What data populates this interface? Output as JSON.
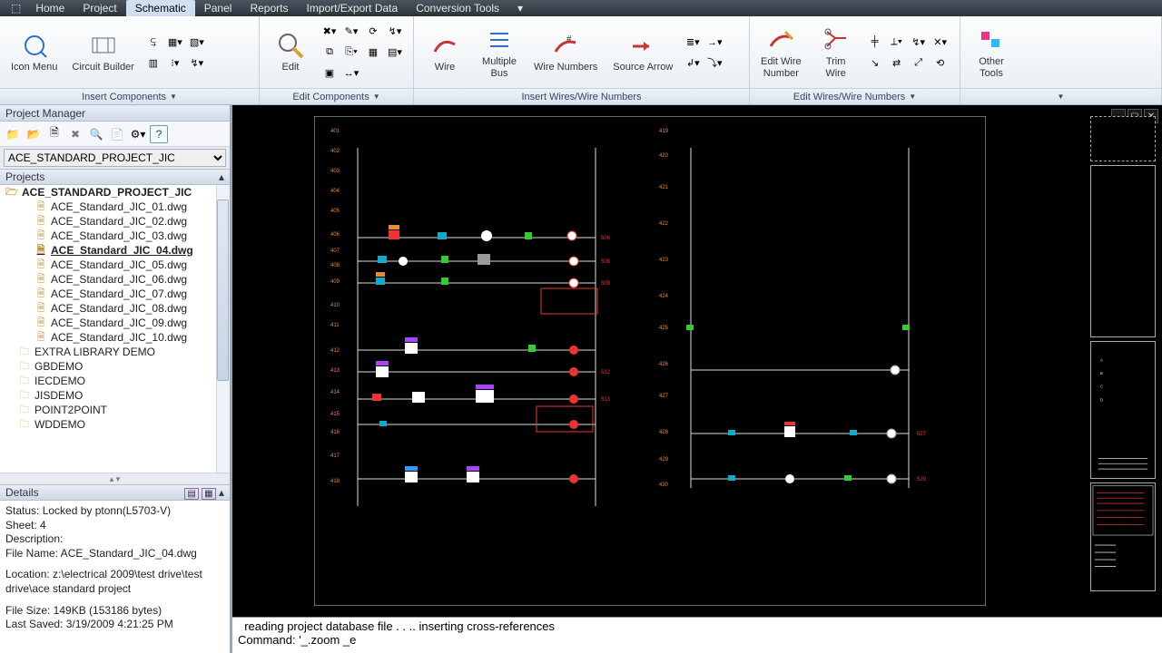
{
  "menu": {
    "items": [
      "Home",
      "Project",
      "Schematic",
      "Panel",
      "Reports",
      "Import/Export Data",
      "Conversion Tools"
    ],
    "active_index": 2
  },
  "ribbon": {
    "groups": [
      {
        "title": "Insert Components",
        "big": [
          {
            "label": "Icon Menu"
          },
          {
            "label": "Circuit Builder"
          }
        ],
        "has_caret": true
      },
      {
        "title": "Edit Components",
        "big": [
          {
            "label": "Edit"
          }
        ],
        "has_caret": true
      },
      {
        "title": "Insert Wires/Wire Numbers",
        "big": [
          {
            "label": "Wire"
          },
          {
            "label": "Multiple\nBus"
          },
          {
            "label": "Wire Numbers"
          },
          {
            "label": "Source Arrow"
          }
        ],
        "has_caret": false
      },
      {
        "title": "Edit Wires/Wire Numbers",
        "big": [
          {
            "label": "Edit Wire\nNumber"
          },
          {
            "label": "Trim\nWire"
          }
        ],
        "has_caret": true
      },
      {
        "title": "",
        "big": [
          {
            "label": "Other\nTools"
          }
        ],
        "has_caret": true
      }
    ]
  },
  "project_manager": {
    "title": "Project Manager",
    "dropdown": "ACE_STANDARD_PROJECT_JIC",
    "section_projects": "Projects",
    "section_details": "Details",
    "tree": {
      "project": "ACE_STANDARD_PROJECT_JIC",
      "drawings": [
        "ACE_Standard_JIC_01.dwg",
        "ACE_Standard_JIC_02.dwg",
        "ACE_Standard_JIC_03.dwg",
        "ACE_Standard_JIC_04.dwg",
        "ACE_Standard_JIC_05.dwg",
        "ACE_Standard_JIC_06.dwg",
        "ACE_Standard_JIC_07.dwg",
        "ACE_Standard_JIC_08.dwg",
        "ACE_Standard_JIC_09.dwg",
        "ACE_Standard_JIC_10.dwg"
      ],
      "selected_index": 3,
      "others": [
        "EXTRA LIBRARY DEMO",
        "GBDEMO",
        "IECDEMO",
        "JISDEMO",
        "POINT2POINT",
        "WDDEMO"
      ]
    },
    "details": {
      "status": "Status: Locked by ptonn(L5703-V)",
      "sheet": "Sheet: 4",
      "description": "Description:",
      "filename": "File Name: ACE_Standard_JIC_04.dwg",
      "location": "Location: z:\\electrical 2009\\test drive\\test drive\\ace standard project",
      "filesize": "File Size: 149KB (153186 bytes)",
      "lastsaved": "Last Saved: 3/19/2009 4:21:25 PM"
    }
  },
  "command": {
    "line1": "  reading project database file . . .. inserting cross-references",
    "line2": "Command: '_.zoom _e"
  },
  "colors": {
    "accent": "#2b70c9",
    "bg_dark": "#000"
  }
}
